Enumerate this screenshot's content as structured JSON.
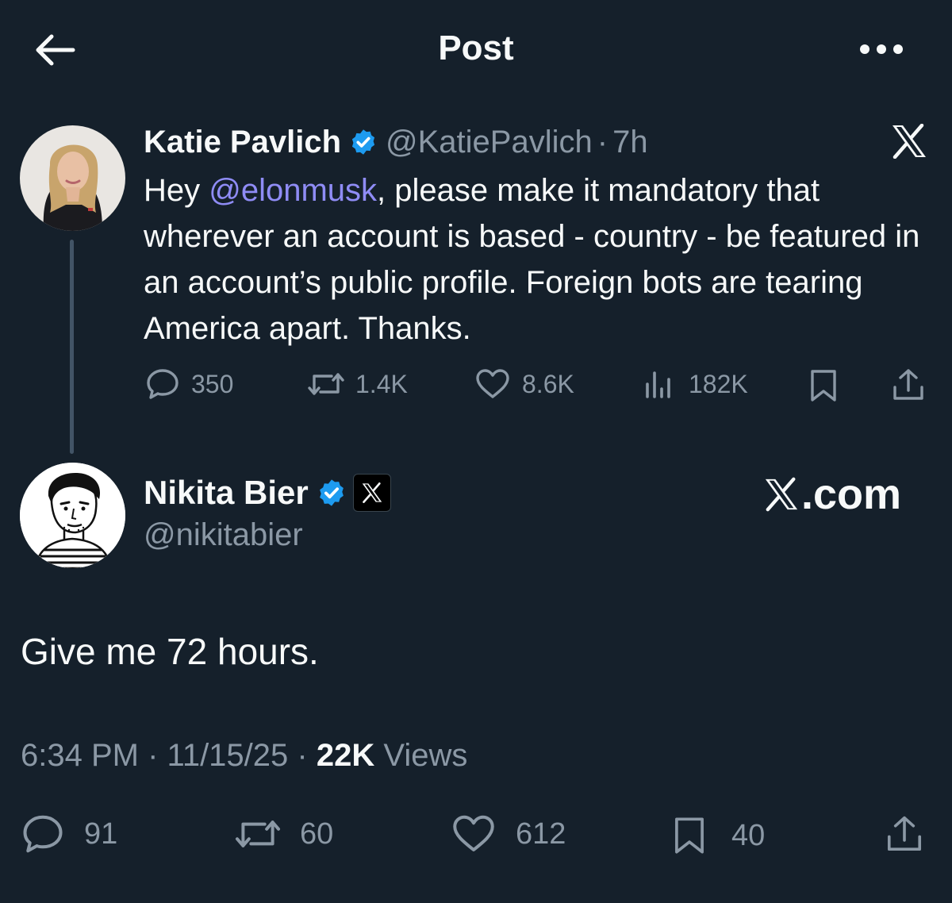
{
  "header": {
    "title": "Post",
    "back_icon": "arrow-left-icon",
    "more_icon": "more-horizontal-icon"
  },
  "parent_tweet": {
    "author": {
      "name": "Katie Pavlich",
      "handle": "@KatiePavlich",
      "verified": true
    },
    "separator": "·",
    "time": "7h",
    "text_prefix": "Hey ",
    "mention": "@elonmusk",
    "text_suffix": ", please make it mandatory that wherever an account is based - country - be featured in an account’s public profile. Foreign bots are tearing America apart. Thanks.",
    "stats": {
      "replies": "350",
      "reposts": "1.4K",
      "likes": "8.6K",
      "views": "182K"
    }
  },
  "main_tweet": {
    "author": {
      "name": "Nikita Bier",
      "handle": "@nikitabier",
      "verified": true,
      "affiliation": "X"
    },
    "link_label": ".com",
    "text": "Give me 72 hours.",
    "meta": {
      "time": "6:34 PM",
      "separator": "·",
      "date": "11/15/25",
      "views_count": "22K",
      "views_label": "Views"
    },
    "stats": {
      "replies": "91",
      "reposts": "60",
      "likes": "612",
      "bookmarks": "40"
    }
  },
  "colors": {
    "background": "#15202b",
    "text": "#f7f9f9",
    "muted": "#8b98a5",
    "mention": "#8f8cf5",
    "verified": "#1d9bf0",
    "thread_line": "#425466"
  }
}
